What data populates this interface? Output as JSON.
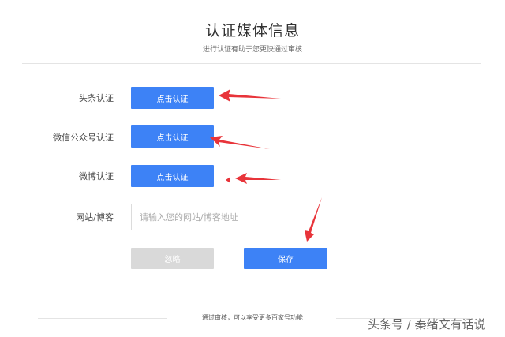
{
  "header": {
    "title": "认证媒体信息",
    "subtitle": "进行认证有助于您更快通过审核"
  },
  "rows": [
    {
      "label": "头条认证",
      "button": "点击认证"
    },
    {
      "label": "微信公众号认证",
      "button": "点击认证"
    },
    {
      "label": "微博认证",
      "button": "点击认证"
    }
  ],
  "website": {
    "label": "网站/博客",
    "placeholder": "请输入您的网站/博客地址"
  },
  "actions": {
    "skip": "忽略",
    "save": "保存"
  },
  "footer": {
    "text": "通过审核，可以享受更多百家号功能"
  },
  "watermark": "头条号 / 秦绪文有话说",
  "colors": {
    "primary": "#3d82f6",
    "disabled": "#d9d9d9",
    "arrow": "#e8343a"
  }
}
